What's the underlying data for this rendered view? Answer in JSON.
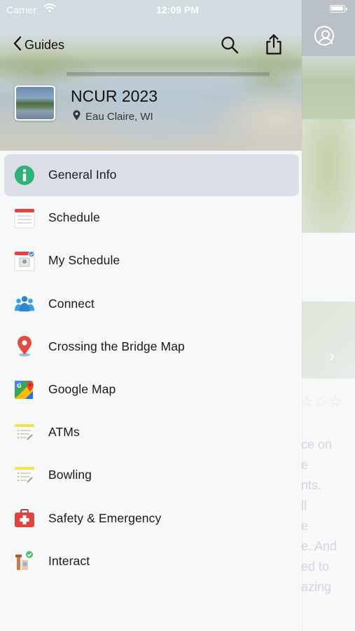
{
  "status_bar": {
    "carrier": "Carrier",
    "time": "12:09 PM"
  },
  "header": {
    "back_label": "Guides",
    "guide_title": "NCUR 2023",
    "guide_location": "Eau Claire, WI"
  },
  "menu": {
    "items": [
      {
        "label": "General Info",
        "icon": "info-icon",
        "selected": true
      },
      {
        "label": "Schedule",
        "icon": "calendar-icon"
      },
      {
        "label": "My Schedule",
        "icon": "my-schedule-icon"
      },
      {
        "label": "Connect",
        "icon": "people-icon"
      },
      {
        "label": "Crossing the Bridge Map",
        "icon": "map-pin-icon"
      },
      {
        "label": "Google Map",
        "icon": "google-maps-icon"
      },
      {
        "label": "ATMs",
        "icon": "list-note-icon"
      },
      {
        "label": "Bowling",
        "icon": "list-note-icon"
      },
      {
        "label": "Safety & Emergency",
        "icon": "first-aid-icon"
      },
      {
        "label": "Interact",
        "icon": "interact-icon"
      }
    ]
  },
  "background_page": {
    "text_lines": [
      "ce on",
      "e",
      "nts.",
      "ll",
      "e",
      "e. And",
      "ed to",
      "azing"
    ],
    "rating_stars": "☆☆☆"
  },
  "colors": {
    "selected_row": "#dcdfe7",
    "info_green": "#2fb277",
    "calendar_red": "#e0443f",
    "pin_red": "#e54b3c"
  }
}
